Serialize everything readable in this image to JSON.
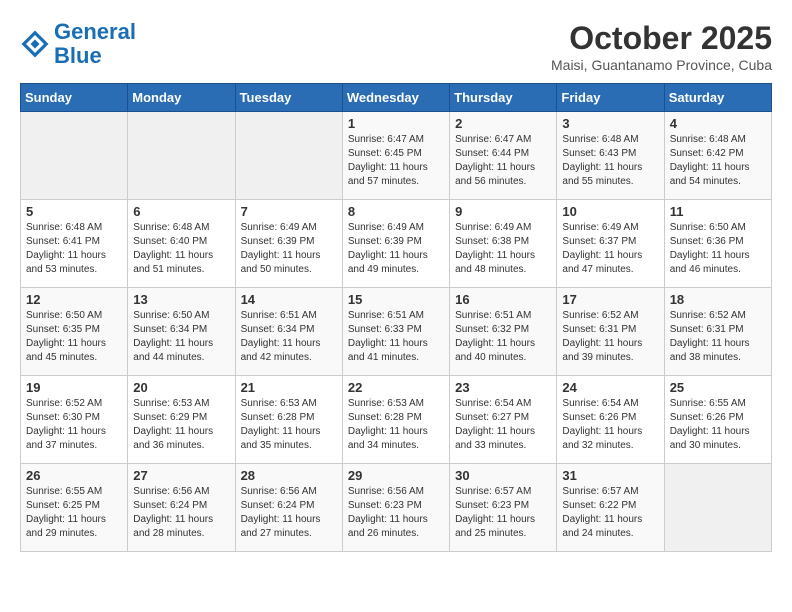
{
  "header": {
    "logo_line1": "General",
    "logo_line2": "Blue",
    "month": "October 2025",
    "location": "Maisi, Guantanamo Province, Cuba"
  },
  "days_of_week": [
    "Sunday",
    "Monday",
    "Tuesday",
    "Wednesday",
    "Thursday",
    "Friday",
    "Saturday"
  ],
  "weeks": [
    [
      {
        "num": "",
        "info": ""
      },
      {
        "num": "",
        "info": ""
      },
      {
        "num": "",
        "info": ""
      },
      {
        "num": "1",
        "info": "Sunrise: 6:47 AM\nSunset: 6:45 PM\nDaylight: 11 hours and 57 minutes."
      },
      {
        "num": "2",
        "info": "Sunrise: 6:47 AM\nSunset: 6:44 PM\nDaylight: 11 hours and 56 minutes."
      },
      {
        "num": "3",
        "info": "Sunrise: 6:48 AM\nSunset: 6:43 PM\nDaylight: 11 hours and 55 minutes."
      },
      {
        "num": "4",
        "info": "Sunrise: 6:48 AM\nSunset: 6:42 PM\nDaylight: 11 hours and 54 minutes."
      }
    ],
    [
      {
        "num": "5",
        "info": "Sunrise: 6:48 AM\nSunset: 6:41 PM\nDaylight: 11 hours and 53 minutes."
      },
      {
        "num": "6",
        "info": "Sunrise: 6:48 AM\nSunset: 6:40 PM\nDaylight: 11 hours and 51 minutes."
      },
      {
        "num": "7",
        "info": "Sunrise: 6:49 AM\nSunset: 6:39 PM\nDaylight: 11 hours and 50 minutes."
      },
      {
        "num": "8",
        "info": "Sunrise: 6:49 AM\nSunset: 6:39 PM\nDaylight: 11 hours and 49 minutes."
      },
      {
        "num": "9",
        "info": "Sunrise: 6:49 AM\nSunset: 6:38 PM\nDaylight: 11 hours and 48 minutes."
      },
      {
        "num": "10",
        "info": "Sunrise: 6:49 AM\nSunset: 6:37 PM\nDaylight: 11 hours and 47 minutes."
      },
      {
        "num": "11",
        "info": "Sunrise: 6:50 AM\nSunset: 6:36 PM\nDaylight: 11 hours and 46 minutes."
      }
    ],
    [
      {
        "num": "12",
        "info": "Sunrise: 6:50 AM\nSunset: 6:35 PM\nDaylight: 11 hours and 45 minutes."
      },
      {
        "num": "13",
        "info": "Sunrise: 6:50 AM\nSunset: 6:34 PM\nDaylight: 11 hours and 44 minutes."
      },
      {
        "num": "14",
        "info": "Sunrise: 6:51 AM\nSunset: 6:34 PM\nDaylight: 11 hours and 42 minutes."
      },
      {
        "num": "15",
        "info": "Sunrise: 6:51 AM\nSunset: 6:33 PM\nDaylight: 11 hours and 41 minutes."
      },
      {
        "num": "16",
        "info": "Sunrise: 6:51 AM\nSunset: 6:32 PM\nDaylight: 11 hours and 40 minutes."
      },
      {
        "num": "17",
        "info": "Sunrise: 6:52 AM\nSunset: 6:31 PM\nDaylight: 11 hours and 39 minutes."
      },
      {
        "num": "18",
        "info": "Sunrise: 6:52 AM\nSunset: 6:31 PM\nDaylight: 11 hours and 38 minutes."
      }
    ],
    [
      {
        "num": "19",
        "info": "Sunrise: 6:52 AM\nSunset: 6:30 PM\nDaylight: 11 hours and 37 minutes."
      },
      {
        "num": "20",
        "info": "Sunrise: 6:53 AM\nSunset: 6:29 PM\nDaylight: 11 hours and 36 minutes."
      },
      {
        "num": "21",
        "info": "Sunrise: 6:53 AM\nSunset: 6:28 PM\nDaylight: 11 hours and 35 minutes."
      },
      {
        "num": "22",
        "info": "Sunrise: 6:53 AM\nSunset: 6:28 PM\nDaylight: 11 hours and 34 minutes."
      },
      {
        "num": "23",
        "info": "Sunrise: 6:54 AM\nSunset: 6:27 PM\nDaylight: 11 hours and 33 minutes."
      },
      {
        "num": "24",
        "info": "Sunrise: 6:54 AM\nSunset: 6:26 PM\nDaylight: 11 hours and 32 minutes."
      },
      {
        "num": "25",
        "info": "Sunrise: 6:55 AM\nSunset: 6:26 PM\nDaylight: 11 hours and 30 minutes."
      }
    ],
    [
      {
        "num": "26",
        "info": "Sunrise: 6:55 AM\nSunset: 6:25 PM\nDaylight: 11 hours and 29 minutes."
      },
      {
        "num": "27",
        "info": "Sunrise: 6:56 AM\nSunset: 6:24 PM\nDaylight: 11 hours and 28 minutes."
      },
      {
        "num": "28",
        "info": "Sunrise: 6:56 AM\nSunset: 6:24 PM\nDaylight: 11 hours and 27 minutes."
      },
      {
        "num": "29",
        "info": "Sunrise: 6:56 AM\nSunset: 6:23 PM\nDaylight: 11 hours and 26 minutes."
      },
      {
        "num": "30",
        "info": "Sunrise: 6:57 AM\nSunset: 6:23 PM\nDaylight: 11 hours and 25 minutes."
      },
      {
        "num": "31",
        "info": "Sunrise: 6:57 AM\nSunset: 6:22 PM\nDaylight: 11 hours and 24 minutes."
      },
      {
        "num": "",
        "info": ""
      }
    ]
  ]
}
